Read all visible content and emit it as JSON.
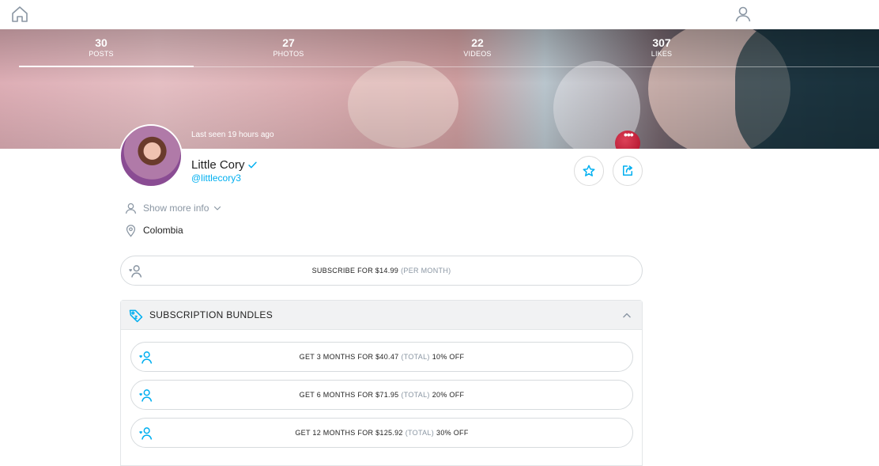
{
  "stats": [
    {
      "num": "30",
      "label": "POSTS"
    },
    {
      "num": "27",
      "label": "PHOTOS"
    },
    {
      "num": "22",
      "label": "VIDEOS"
    },
    {
      "num": "307",
      "label": "LIKES"
    }
  ],
  "profile": {
    "last_seen": "Last seen 19 hours ago",
    "name": "Little Cory",
    "handle": "@littlecory3",
    "more_dots": "•••",
    "show_more": "Show more info",
    "location": "Colombia"
  },
  "subscribe": {
    "label": "SUBSCRIBE FOR $14.99",
    "period": "(PER MONTH)"
  },
  "bundles": {
    "title": "SUBSCRIPTION BUNDLES",
    "items": [
      {
        "pre": "GET 3 MONTHS FOR $40.47",
        "total": "(TOTAL)",
        "off": "10% OFF"
      },
      {
        "pre": "GET 6 MONTHS FOR $71.95",
        "total": "(TOTAL)",
        "off": "20% OFF"
      },
      {
        "pre": "GET 12 MONTHS FOR $125.92",
        "total": "(TOTAL)",
        "off": "30% OFF"
      }
    ]
  },
  "colors": {
    "accent": "#00aff0",
    "muted": "#8a96a3",
    "border": "#d7dbde"
  },
  "icons": [
    "home-icon",
    "user-icon",
    "verified-icon",
    "star-icon",
    "share-icon",
    "person-icon",
    "chevron-down-icon",
    "location-pin-icon",
    "subscribe-icon",
    "tag-icon",
    "chevron-up-icon"
  ]
}
